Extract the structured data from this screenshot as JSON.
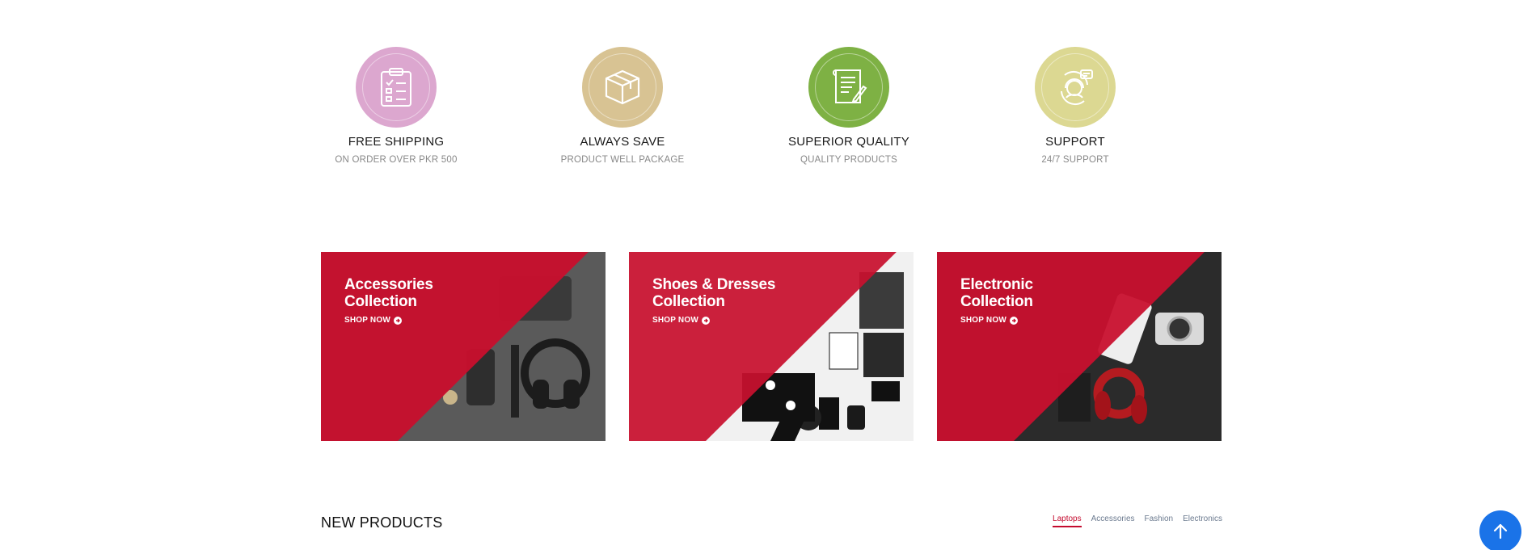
{
  "features": [
    {
      "title": "FREE SHIPPING",
      "subtitle": "ON ORDER OVER PKR 500",
      "icon": "clipboard-checklist-icon",
      "color": "#dca7cf"
    },
    {
      "title": "ALWAYS SAVE",
      "subtitle": "PRODUCT WELL PACKAGE",
      "icon": "box-icon",
      "color": "#d8c393"
    },
    {
      "title": "SUPERIOR QUALITY",
      "subtitle": "QUALITY PRODUCTS",
      "icon": "certificate-icon",
      "color": "#7eb144"
    },
    {
      "title": "SUPPORT",
      "subtitle": "24/7 SUPPORT",
      "icon": "support-agent-icon",
      "color": "#dcd892"
    }
  ],
  "banners": [
    {
      "line1": "Accessories",
      "line2": "Collection",
      "cta": "SHOP NOW"
    },
    {
      "line1": "Shoes & Dresses",
      "line2": "Collection",
      "cta": "SHOP NOW"
    },
    {
      "line1": "Electronic",
      "line2": "Collection",
      "cta": "SHOP NOW"
    }
  ],
  "banner_accent": "#c8102e",
  "new_products": {
    "title": "NEW PRODUCTS",
    "tabs": [
      "Laptops",
      "Accessories",
      "Fashion",
      "Electronics"
    ],
    "active_tab": "Laptops"
  },
  "scroll_top": {
    "icon": "arrow-up-icon",
    "color": "#1a73e8"
  }
}
